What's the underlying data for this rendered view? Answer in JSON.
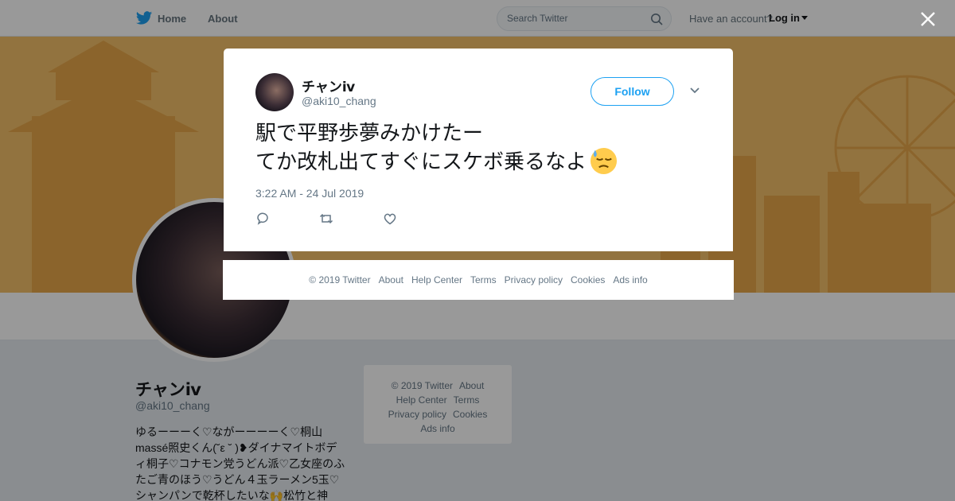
{
  "nav": {
    "home": "Home",
    "about": "About",
    "search_placeholder": "Search Twitter",
    "account_prompt": "Have an account?",
    "login": "Log in"
  },
  "profile": {
    "name": "チャンⅳ",
    "handle": "@aki10_chang",
    "bio": "ゆるーーーく♡ながーーーーく♡桐山massé照史くん(˘ε ˘ )❥ダイナマイトボディ桐子♡コナモン党うどん派♡乙女座のふたご青のほう♡うどん４玉ラーメン5玉♡シャンパンで乾杯したいな🙌松竹と神"
  },
  "side_footer": {
    "row1": [
      "© 2019 Twitter",
      "About"
    ],
    "row2": [
      "Help Center",
      "Terms"
    ],
    "row3": [
      "Privacy policy",
      "Cookies"
    ],
    "row4": [
      "Ads info"
    ]
  },
  "tweet": {
    "author_name": "チャンⅳ",
    "author_handle": "@aki10_chang",
    "follow_label": "Follow",
    "line1": "駅で平野歩夢みかけたー",
    "line2": "てか改札出てすぐにスケボ乗るなよ",
    "time": "3:22 AM - 24 Jul 2019"
  },
  "modal_footer": {
    "copyright": "© 2019 Twitter",
    "about": "About",
    "help": "Help Center",
    "terms": "Terms",
    "privacy": "Privacy policy",
    "cookies": "Cookies",
    "ads": "Ads info"
  },
  "colors": {
    "brand": "#1da1f2",
    "banner": "#f3c06a",
    "text": "#14171a",
    "muted": "#657786"
  },
  "icons": [
    "twitter-bird-icon",
    "search-icon",
    "close-icon",
    "chevron-down-icon",
    "reply-icon",
    "retweet-icon",
    "like-icon",
    "downcast-sweat-emoji-icon"
  ]
}
